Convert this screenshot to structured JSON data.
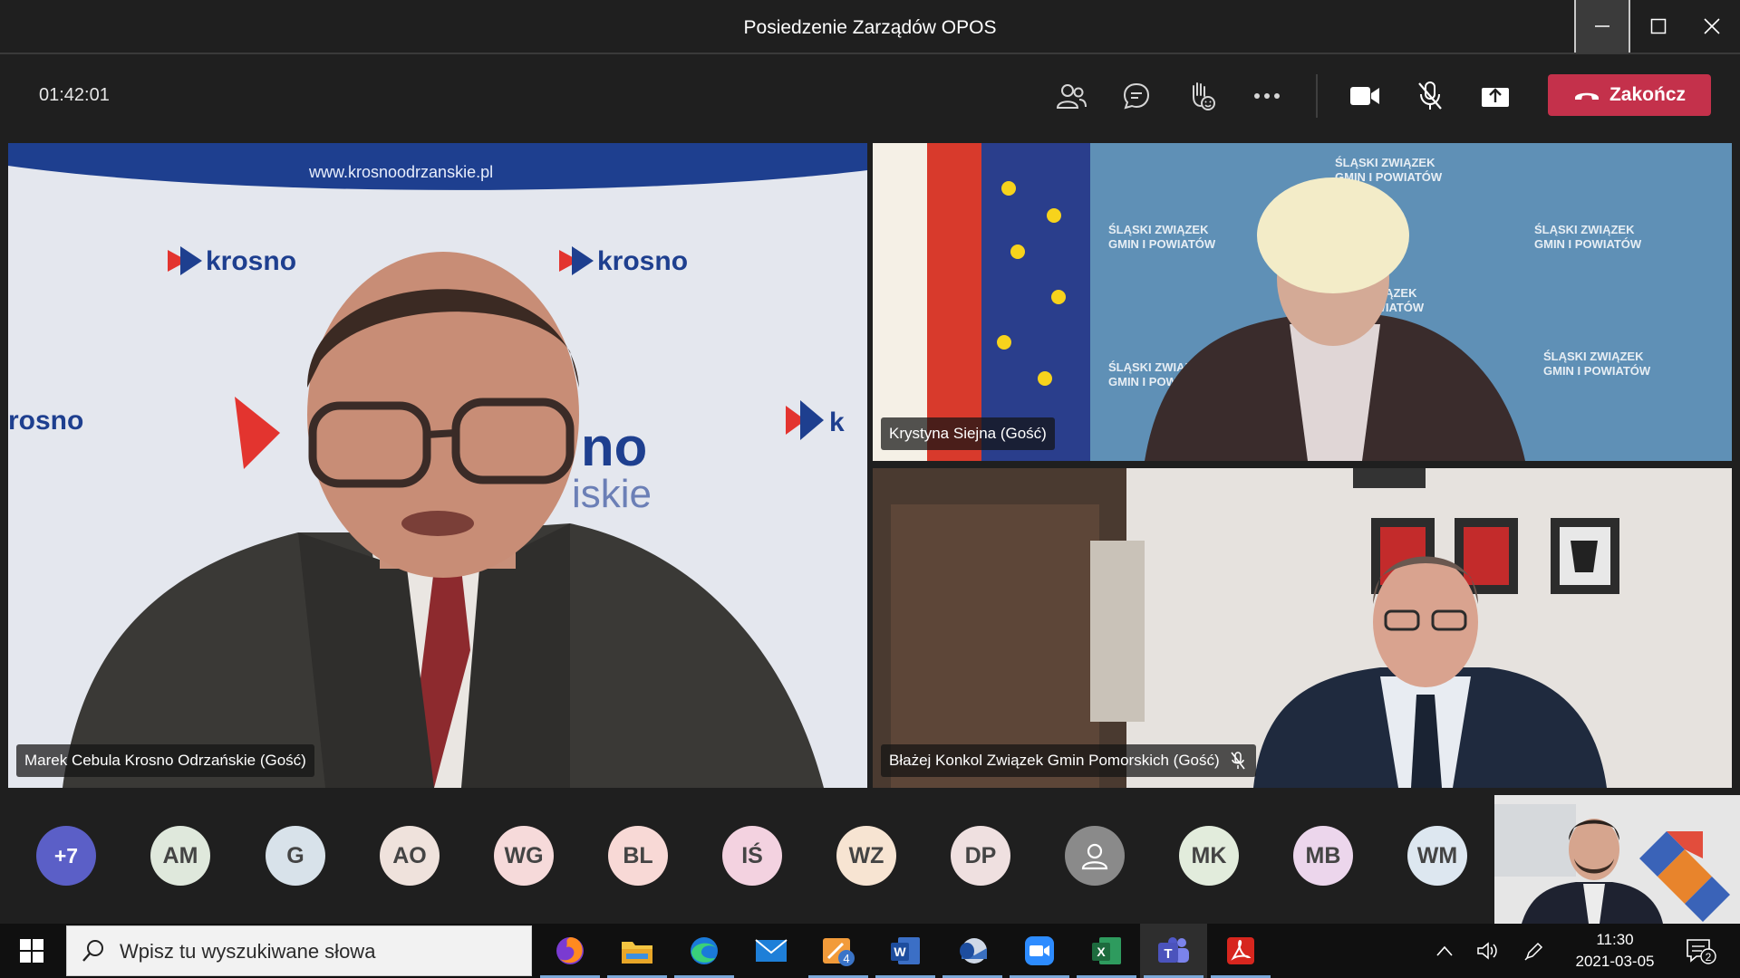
{
  "window": {
    "title": "Posiedzenie Zarządów OPOS"
  },
  "toolbar": {
    "elapsed_time": "01:42:01",
    "end_call_label": "Zakończ",
    "icons": [
      "participants-icon",
      "chat-icon",
      "raise-hand-icon",
      "more-options-icon",
      "camera-icon",
      "microphone-muted-icon",
      "share-screen-icon",
      "phone-hangup-icon"
    ]
  },
  "video_tiles": [
    {
      "name": "Marek Cebula Krosno Odrzańskie (Gość)",
      "muted": false,
      "backdrop_text": [
        "www.krosnoodrzanskie.pl",
        "krosno",
        "krosno",
        "rosno",
        "no",
        "iskie",
        "k"
      ]
    },
    {
      "name": "Krystyna Siejna (Gość)",
      "muted": false,
      "backdrop_text": [
        "ŚLĄSKI ZWIĄZEK",
        "GMIN I POWIATÓW"
      ]
    },
    {
      "name": "Błażej Konkol Związek Gmin Pomorskich (Gość)",
      "muted": true
    }
  ],
  "participants": {
    "overflow_label": "+7",
    "avatars": [
      {
        "initials": "AM",
        "color": "#dfe8dc"
      },
      {
        "initials": "G",
        "color": "#d8e2ea"
      },
      {
        "initials": "AO",
        "color": "#efe2dc"
      },
      {
        "initials": "WG",
        "color": "#f6dada"
      },
      {
        "initials": "BL",
        "color": "#f8d9d6"
      },
      {
        "initials": "IŚ",
        "color": "#f3d2e0"
      },
      {
        "initials": "WZ",
        "color": "#f7e4d2"
      },
      {
        "initials": "DP",
        "color": "#efe0e0"
      },
      {
        "initials": "",
        "color": "#8a8a8a",
        "icon": "person-icon"
      },
      {
        "initials": "MK",
        "color": "#e2ecdc"
      },
      {
        "initials": "MB",
        "color": "#ecd6ec"
      },
      {
        "initials": "WM",
        "color": "#dde7f0"
      }
    ]
  },
  "taskbar": {
    "search_placeholder": "Wpisz tu wyszukiwane słowa",
    "apps": [
      "firefox-icon",
      "file-explorer-icon",
      "edge-icon",
      "mail-icon",
      "app-badge-icon",
      "word-icon",
      "outlook-icon",
      "zoom-icon",
      "excel-icon",
      "teams-icon",
      "acrobat-icon"
    ],
    "app_badge_count": "4",
    "clock_time": "11:30",
    "clock_date": "2021-03-05",
    "notification_count": "2"
  },
  "colors": {
    "end_call": "#c4314b",
    "overflow_avatar": "#5b5fc7",
    "taskbar": "#101010"
  }
}
